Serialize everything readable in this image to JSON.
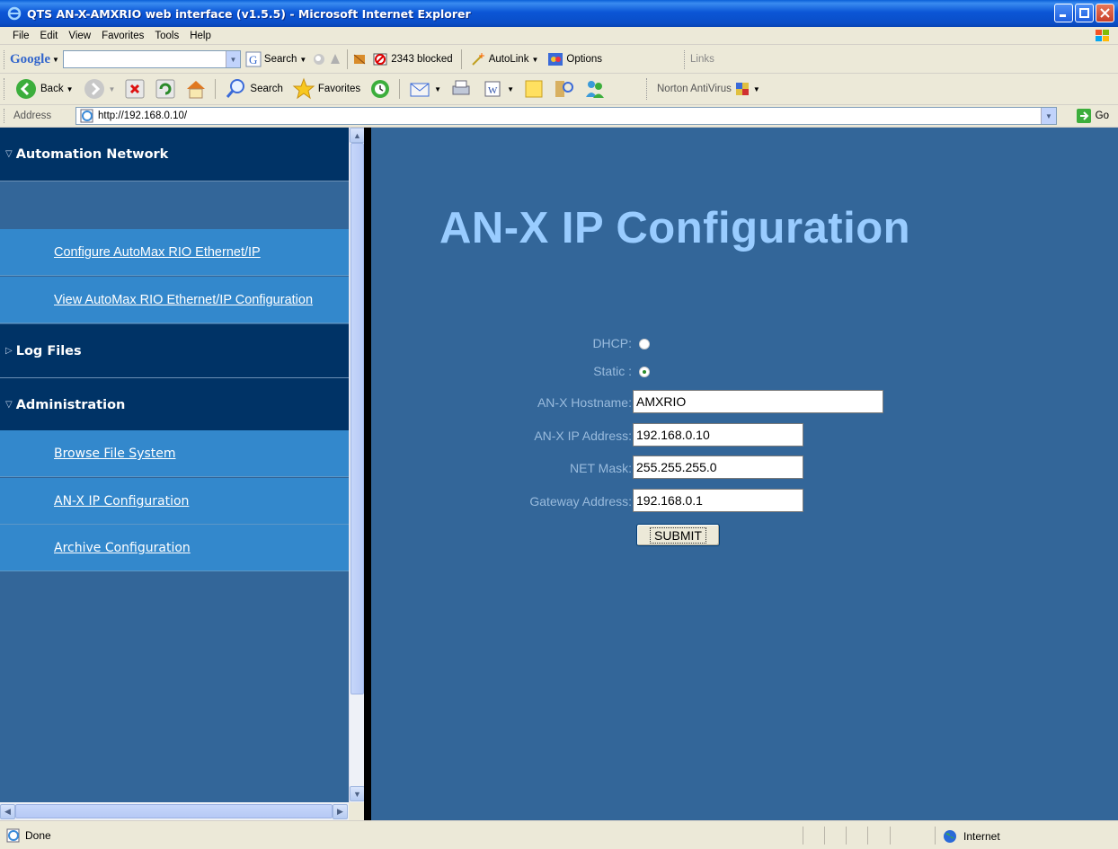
{
  "window": {
    "title": "QTS AN-X-AMXRIO web interface (v1.5.5) - Microsoft Internet Explorer"
  },
  "menu": [
    "File",
    "Edit",
    "View",
    "Favorites",
    "Tools",
    "Help"
  ],
  "google_toolbar": {
    "logo": "Google",
    "search_label": "Search",
    "blocked_label": "2343 blocked",
    "autolink_label": "AutoLink",
    "options_label": "Options",
    "links_label": "Links"
  },
  "nav_toolbar": {
    "back_label": "Back",
    "search_label": "Search",
    "favorites_label": "Favorites",
    "norton_label": "Norton AntiVirus"
  },
  "address": {
    "label": "Address",
    "url": "http://192.168.0.10/",
    "go_label": "Go"
  },
  "sidebar": {
    "sections": [
      {
        "label": "Automation Network",
        "expanded": true
      },
      {
        "label": "Log Files",
        "expanded": false
      },
      {
        "label": "Administration",
        "expanded": true
      }
    ],
    "items": [
      {
        "label": "Configure AutoMax RIO Ethernet/IP"
      },
      {
        "label": "View AutoMax RIO Ethernet/IP Configuration"
      },
      {
        "label": "Browse File System"
      },
      {
        "label": "AN-X IP Configuration"
      },
      {
        "label": "Archive Configuration"
      }
    ]
  },
  "main": {
    "title": "AN-X IP Configuration",
    "dhcp_label": "DHCP:",
    "static_label": "Static :",
    "selected_mode": "Static",
    "hostname_label": "AN-X Hostname:",
    "hostname_value": "AMXRIO",
    "ip_label": "AN-X IP Address:",
    "ip_value": "192.168.0.10",
    "mask_label": "NET Mask:",
    "mask_value": "255.255.255.0",
    "gateway_label": "Gateway Address:",
    "gateway_value": "192.168.0.1",
    "submit_label": "SUBMIT"
  },
  "status": {
    "text": "Done",
    "zone": "Internet"
  },
  "colors": {
    "frame_bg": "#336699",
    "nav_header": "#003366",
    "nav_item": "#3388cc",
    "title_color": "#99ccff"
  }
}
